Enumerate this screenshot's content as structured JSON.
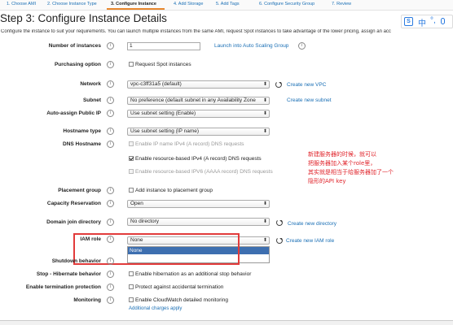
{
  "wizard": {
    "steps": [
      "1. Choose AMI",
      "2. Choose Instance Type",
      "3. Configure Instance",
      "4. Add Storage",
      "5. Add Tags",
      "6. Configure Security Group",
      "7. Review"
    ]
  },
  "page": {
    "title": "Step 3: Configure Instance Details",
    "description": "Configure the instance to suit your requirements. You can launch multiple instances from the same AMI, request Spot instances to take advantage of the lower pricing, assign an acc"
  },
  "ime": {
    "logo": "S",
    "lang": "中",
    "punct": "°,"
  },
  "fields": {
    "number_of_instances": {
      "label": "Number of instances",
      "value": "1",
      "link": "Launch into Auto Scaling Group"
    },
    "purchasing_option": {
      "label": "Purchasing option",
      "checkbox": "Request Spot instances"
    },
    "network": {
      "label": "Network",
      "value": "vpc-c3ff31a5 (default)",
      "link": "Create new VPC"
    },
    "subnet": {
      "label": "Subnet",
      "value": "No preference (default subnet in any Availability Zone",
      "link": "Create new subnet"
    },
    "auto_assign_ip": {
      "label": "Auto-assign Public IP",
      "value": "Use subnet setting (Enable)"
    },
    "hostname_type": {
      "label": "Hostname type",
      "value": "Use subnet setting (IP name)"
    },
    "dns_hostname": {
      "label": "DNS Hostname",
      "opt1": "Enable IP name IPv4 (A record) DNS requests",
      "opt2": "Enable resource-based IPv4 (A record) DNS requests",
      "opt3": "Enable resource-based IPV6 (AAAA record) DNS requests"
    },
    "placement_group": {
      "label": "Placement group",
      "checkbox": "Add instance to placement group"
    },
    "capacity_reservation": {
      "label": "Capacity Reservation",
      "value": "Open"
    },
    "domain_join": {
      "label": "Domain join directory",
      "value": "No directory",
      "link": "Create new directory"
    },
    "iam_role": {
      "label": "IAM role",
      "value": "None",
      "link": "Create new IAM role",
      "options": [
        "None",
        ""
      ]
    },
    "shutdown_behavior": {
      "label": "Shutdown behavior"
    },
    "stop_hibernate": {
      "label": "Stop - Hibernate behavior",
      "checkbox": "Enable hibernation as an additional stop behavior"
    },
    "termination_protection": {
      "label": "Enable termination protection",
      "checkbox": "Protect against accidental termination"
    },
    "monitoring": {
      "label": "Monitoring",
      "checkbox": "Enable CloudWatch detailed monitoring",
      "more": "Additional charges apply"
    }
  },
  "annotation": {
    "lines": [
      "新建服务器的时候，就可以",
      "把服务器加入某个role里，",
      "其实就是相当于给服务器加了一个",
      "隐形的API  key"
    ]
  },
  "colors": {
    "link": "#1a6fb5",
    "highlight": "#e23b3b",
    "annotation": "#e0242b",
    "selected_option": "#3d6fb0"
  }
}
